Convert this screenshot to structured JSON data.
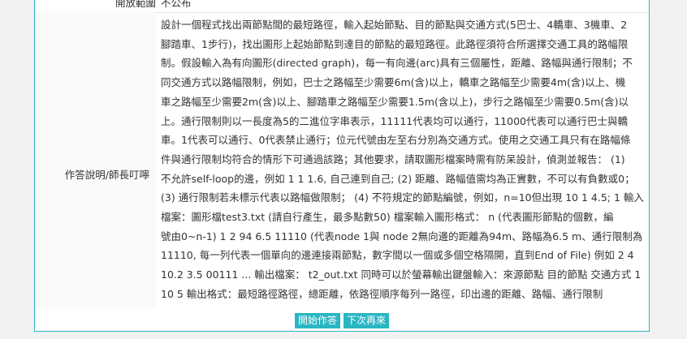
{
  "top_row": {
    "label": "開放範圍",
    "value": "不公布"
  },
  "instruction": {
    "label": "作答說明/師長叮嚀",
    "lines": [
      "設計一個程式找出兩節點間的最短路徑，輸入起始節點、目的節點與交通方式(5巴士、4轎車、3機車、2",
      "腳踏車、1步行)，找出圖形上起始節點到達目的節點的最短路徑。此路徑須符合所選擇交通工具的路幅限",
      "制。假設輸入為有向圖形(directed graph)，每一有向邊(arc)具有三個屬性，距離、路幅與通行限制；不",
      "同交通方式以路幅限制，例如，巴士之路幅至少需要6m(含)以上，轎車之路幅至少需要4m(含)以上、機",
      "車之路幅至少需要2m(含)以上、腳踏車之路幅至少需要1.5m(含以上)，步行之路幅至少需要0.5m(含)以",
      "上。通行限制則以一長度為5的二進位字串表示，11111代表均可以通行，11000代表可以通行巴士與轎",
      "車。1代表可以通行、0代表禁止通行；位元代號由左至右分別為交通方式。使用之交通工具只有在路幅條",
      "件與通行限制均符合的情形下可通過該路；其他要求，請取圖形檔案時需有防呆設計，偵測並報告： (1)",
      "不允許self-loop的邊，例如 1 1 1.6, 自己連到自己; (2) 距離、路幅值需均為正實數，不可以有負數或0；",
      "(3) 通行限制若未標示代表以路幅做限制； (4) 不符規定的節點編號，例如，n=10但出現 10 1 4.5; 1 輸入",
      "檔案：圖形檔test3.txt (請自行產生，最多點數50) 檔案輸入圖形格式： n (代表圖形節點的個數，編",
      "號由0~n-1) 1 2 94 6.5 11110 (代表node 1與 node 2無向邊的距離為94m、路幅為6.5 m、通行限制為",
      "11110, 每一列代表一個單向的邊連接兩節點，數字間以一個或多個空格隔開，直到End of File) 例如 2 4",
      "10.2 3.5 00111 ... 輸出檔案： t2_out.txt 同時可以於螢幕輸出鍵盤輸入：來源節點 目的節點 交通方式 1",
      "10 5 輸出格式：最短路徑路徑，總距離，依路徑順序每列一路徑，印出邊的距離、路幅、通行限制"
    ]
  },
  "buttons": {
    "start": "開始作答",
    "next": "下次再來"
  },
  "colors": {
    "accent": "#29b6c4"
  }
}
